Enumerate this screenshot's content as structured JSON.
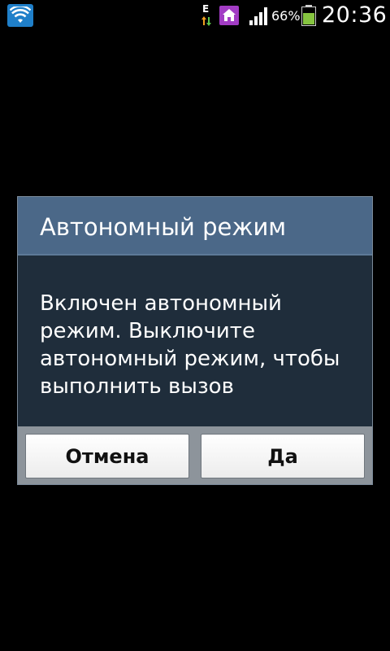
{
  "status_bar": {
    "network_type": "E",
    "battery_percent": "66%",
    "time": "20:36",
    "icons": [
      "wifi-icon",
      "data-arrows-icon",
      "home-icon",
      "signal-icon",
      "battery-icon"
    ]
  },
  "dialog": {
    "title": "Автономный режим",
    "message": "Включен автономный режим. Выключите автономный режим, чтобы выполнить вызов",
    "cancel_label": "Отмена",
    "ok_label": "Да"
  },
  "colors": {
    "wifi": "#1f7fc9",
    "home": "#a23cc4",
    "battery": "#86c440",
    "title_bar": "#4b6888",
    "dialog_body": "#1f2d3b",
    "button_bar": "#8d949b"
  }
}
